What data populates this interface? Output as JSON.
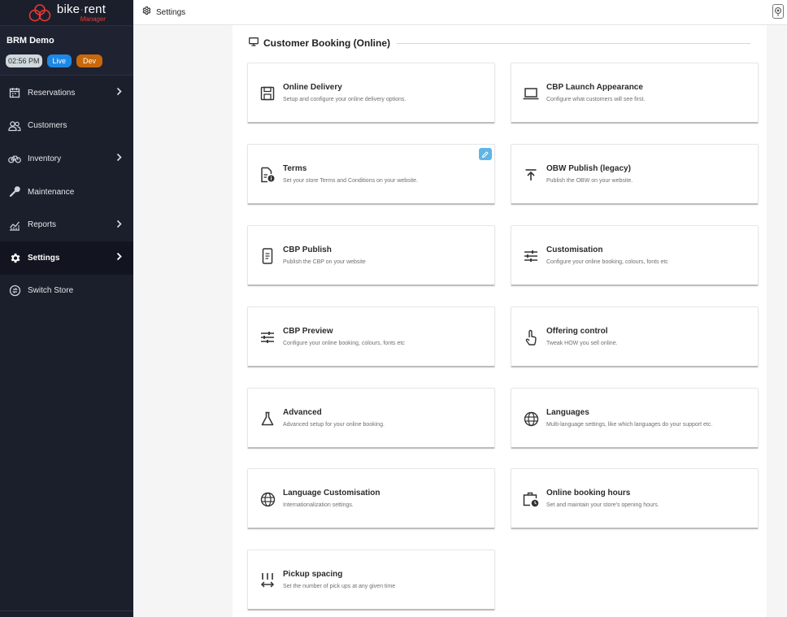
{
  "brand": {
    "name_part1": "bike",
    "name_dot": "·",
    "name_part2": "rent",
    "subtitle": "Manager"
  },
  "store": {
    "name": "BRM Demo",
    "time": "02:56 PM",
    "live_label": "Live",
    "dev_label": "Dev"
  },
  "sidebar": {
    "items": [
      {
        "label": "Reservations",
        "icon": "calendar-icon"
      },
      {
        "label": "Customers",
        "icon": "people-icon"
      },
      {
        "label": "Inventory",
        "icon": "bike-icon"
      },
      {
        "label": "Maintenance",
        "icon": "wrench-icon"
      },
      {
        "label": "Reports",
        "icon": "chart-icon"
      },
      {
        "label": "Settings",
        "icon": "gear-icon"
      },
      {
        "label": "Switch Store",
        "icon": "switch-icon"
      }
    ]
  },
  "topbar": {
    "title": "Settings"
  },
  "section": {
    "title": "Customer Booking (Online)"
  },
  "cards": [
    {
      "title": "Online Delivery",
      "desc": "Setup and configure your online delivery options.",
      "icon": "save-icon"
    },
    {
      "title": "CBP Launch Appearance",
      "desc": "Configure what customers will see first.",
      "icon": "laptop-icon"
    },
    {
      "title": "Terms",
      "desc": "Set your store Terms and Conditions on your website.",
      "icon": "document-info-icon"
    },
    {
      "title": "OBW Publish (legacy)",
      "desc": "Publish the OBW on your website.",
      "icon": "publish-icon"
    },
    {
      "title": "CBP Publish",
      "desc": "Publish the CBP on your website",
      "icon": "phone-icon"
    },
    {
      "title": "Customisation",
      "desc": "Configure your online booking, colours, fonts etc",
      "icon": "tune-icon"
    },
    {
      "title": "CBP Preview",
      "desc": "Configure your online booking, colours, fonts etc",
      "icon": "tune-icon"
    },
    {
      "title": "Offering control",
      "desc": "Tweak HOW you sell online.",
      "icon": "touch-icon"
    },
    {
      "title": "Advanced",
      "desc": "Advanced setup for your online booking.",
      "icon": "flask-icon"
    },
    {
      "title": "Languages",
      "desc": "Multi-language settings, like which languages do your support etc.",
      "icon": "globe-icon"
    },
    {
      "title": "Language Customisation",
      "desc": "Internationalization settings.",
      "icon": "globe-icon"
    },
    {
      "title": "Online booking hours",
      "desc": "Set and maintain your store's opening hours.",
      "icon": "briefcase-clock-icon"
    },
    {
      "title": "Pickup spacing",
      "desc": "Set the number of pick ups at any given time",
      "icon": "spacing-icon"
    }
  ],
  "colors": {
    "sidebar": "#1b1f2c",
    "accent_red": "#e53935",
    "live": "#1e88e5",
    "dev": "#c8680a",
    "edit": "#5fb5e8"
  }
}
